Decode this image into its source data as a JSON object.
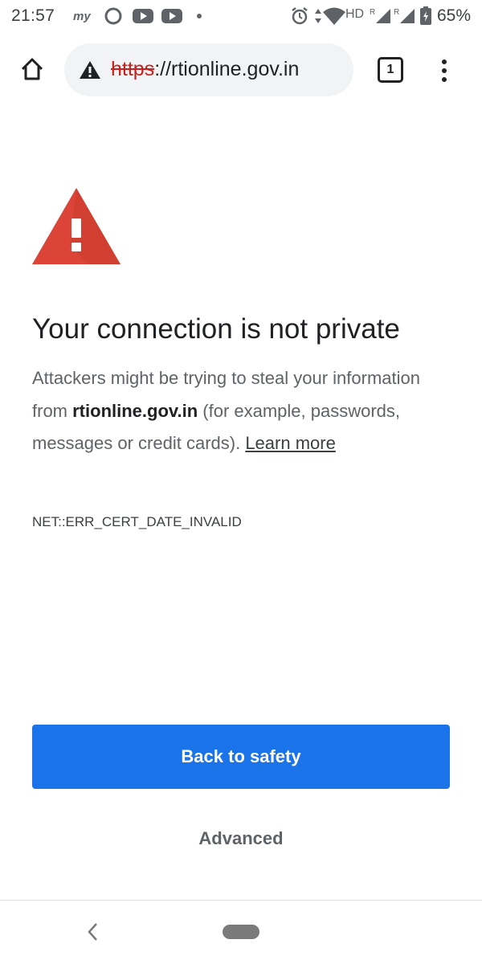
{
  "status_bar": {
    "time": "21:57",
    "battery_percent": "65%",
    "network_label": "HD",
    "roaming_label": "R",
    "icons": [
      "myjio-icon",
      "circle-app-icon",
      "youtube-icon",
      "youtube-icon",
      "dot-icon",
      "alarm-icon",
      "data-arrows-icon",
      "wifi-icon",
      "signal-icon",
      "signal-icon",
      "battery-icon"
    ]
  },
  "toolbar": {
    "url_scheme": "https",
    "url_rest": "://rtionline.gov.in",
    "tab_count": "1",
    "icons": [
      "home-icon",
      "warning-icon",
      "tab-switcher-icon",
      "more-vert-icon"
    ]
  },
  "interstitial": {
    "heading": "Your connection is not private",
    "desc_part1": "Attackers might be trying to steal your information from ",
    "desc_domain": "rtionline.gov.in",
    "desc_part2": " (for example, passwords, messages or credit cards). ",
    "learn_more": "Learn more",
    "error_code": "NET::ERR_CERT_DATE_INVALID",
    "primary_button": "Back to safety",
    "secondary_button": "Advanced",
    "colors": {
      "warning_red": "#db4437",
      "primary_blue": "#1a73e8"
    }
  },
  "nav_bar": {
    "icons": [
      "back-chevron-icon",
      "home-pill-icon"
    ]
  }
}
